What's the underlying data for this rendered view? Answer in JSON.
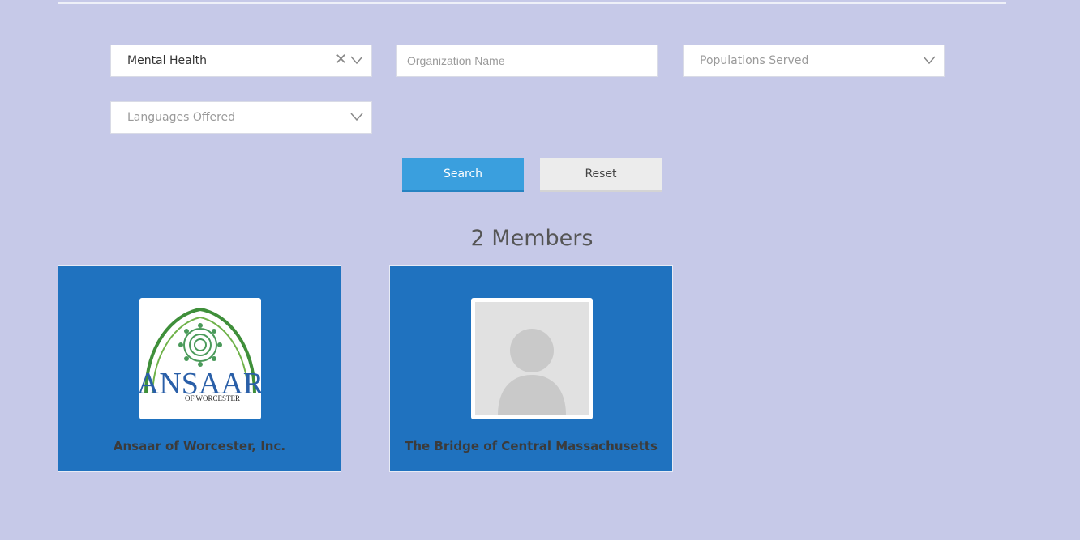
{
  "filters": {
    "category": {
      "value": "Mental Health"
    },
    "organization": {
      "placeholder": "Organization Name",
      "value": ""
    },
    "populations": {
      "placeholder": "Populations Served"
    },
    "languages": {
      "placeholder": "Languages Offered"
    }
  },
  "buttons": {
    "search": "Search",
    "reset": "Reset"
  },
  "results": {
    "count_label": "2 Members"
  },
  "members": [
    {
      "name": "Ansaar of Worcester, Inc.",
      "logo": {
        "wordmark": "ANSAAR",
        "subtitle": "OF WORCESTER",
        "icon": "ansaar-logo"
      }
    },
    {
      "name": "The Bridge of Central Massachusetts",
      "logo": {
        "icon": "placeholder-avatar-icon"
      }
    }
  ],
  "colors": {
    "page_bg": "#c6c9e8",
    "card_bg": "#1f72bf",
    "search_button": "#3a9fde",
    "reset_button": "#ececec"
  }
}
